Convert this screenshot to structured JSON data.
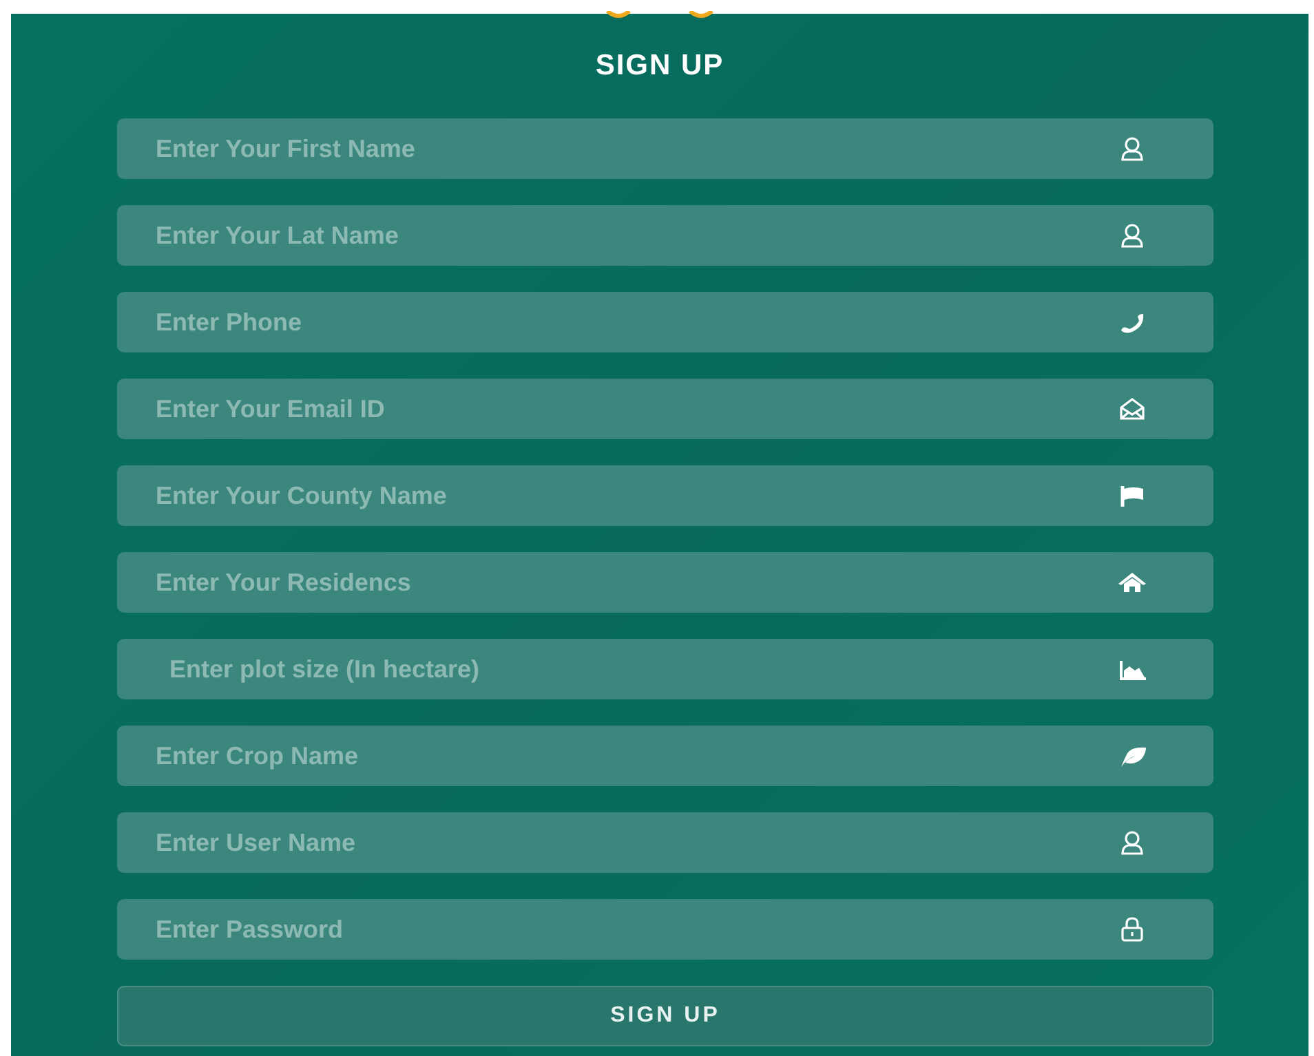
{
  "title": "SIGN UP",
  "fields": [
    {
      "placeholder": "Enter Your First Name",
      "kind": "user"
    },
    {
      "placeholder": "Enter Your Lat Name",
      "kind": "user"
    },
    {
      "placeholder": "Enter Phone",
      "kind": "phone"
    },
    {
      "placeholder": "Enter Your Email ID",
      "kind": "email"
    },
    {
      "placeholder": "Enter Your County Name",
      "kind": "flag"
    },
    {
      "placeholder": "Enter Your Residencs",
      "kind": "home"
    },
    {
      "placeholder": "  Enter plot size (In hectare)",
      "kind": "area"
    },
    {
      "placeholder": "Enter Crop Name",
      "kind": "leaf"
    },
    {
      "placeholder": "Enter User Name",
      "kind": "user"
    },
    {
      "placeholder": "Enter Password",
      "kind": "lock"
    }
  ],
  "submit": "SIGN UP"
}
